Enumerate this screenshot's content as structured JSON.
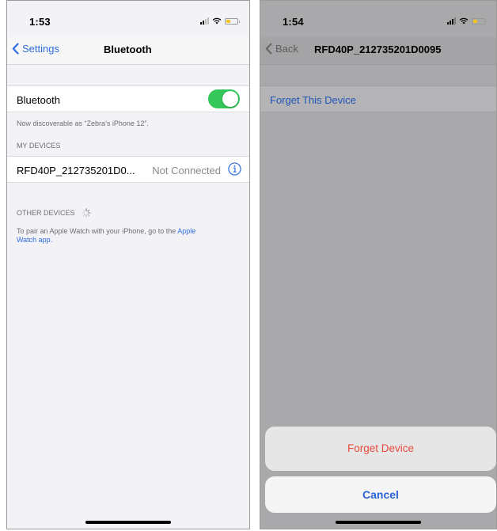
{
  "colors": {
    "ios_blue": "#2f6de0",
    "toggle_green": "#34c759",
    "destructive_red": "#e84b3c",
    "battery_left": "#f5c518",
    "battery_right": "#f5c518"
  },
  "left_screen": {
    "status_bar": {
      "time": "1:53"
    },
    "nav": {
      "back_label": "Settings",
      "title": "Bluetooth"
    },
    "bluetooth_row": {
      "label": "Bluetooth",
      "toggle_on": true
    },
    "discoverable_text": "Now discoverable as “Zebra’s iPhone 12”.",
    "my_devices": {
      "header": "MY DEVICES",
      "items": [
        {
          "name": "RFD40P_212735201D0...",
          "status": "Not Connected",
          "icon": "info-icon"
        }
      ]
    },
    "other_devices": {
      "header": "OTHER DEVICES",
      "icon": "loading-spinner-icon",
      "pair_text": "To pair an Apple Watch with your iPhone, go to the ",
      "pair_link_1": "Apple",
      "pair_link_2": "Watch app."
    }
  },
  "right_screen": {
    "status_bar": {
      "time": "1:54"
    },
    "nav": {
      "back_label": "Back",
      "title": "RFD40P_212735201D0095"
    },
    "forget_row": {
      "label": "Forget This Device"
    },
    "action_sheet": {
      "forget_label": "Forget Device",
      "cancel_label": "Cancel"
    }
  }
}
